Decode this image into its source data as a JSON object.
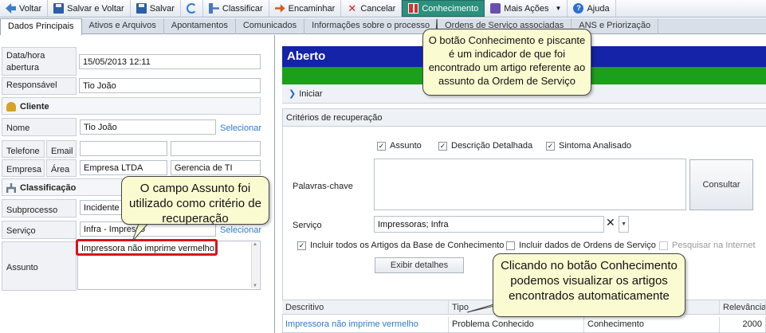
{
  "toolbar": {
    "back": "Voltar",
    "save_back": "Salvar e Voltar",
    "save": "Salvar",
    "classify": "Classificar",
    "forward": "Encaminhar",
    "cancel": "Cancelar",
    "knowledge": "Conhecimento",
    "more_actions": "Mais Ações",
    "help": "Ajuda"
  },
  "tabs": [
    "Dados Principais",
    "Ativos e Arquivos",
    "Apontamentos",
    "Comunicados",
    "Informações sobre o processo",
    "Ordens de Serviço associadas",
    "ANS e Priorização"
  ],
  "form": {
    "date_label": "Data/hora abertura",
    "date_value": "15/05/2013 12:11",
    "responsible_label": "Responsável",
    "responsible_value": "Tio João",
    "client_section": "Cliente",
    "name_label": "Nome",
    "name_value": "Tio João",
    "select_link": "Selecionar",
    "phone_label": "Telefone",
    "email_label": "Email",
    "company_label": "Empresa",
    "area_label": "Área",
    "company_value": "Empresa LTDA",
    "area_value": "Gerencia de TI",
    "classification_section": "Classificação",
    "subprocess_label": "Subprocesso",
    "subprocess_value": "Incidente -",
    "service_label": "Serviço",
    "service_value": "Infra - Impresso",
    "subject_label": "Assunto",
    "subject_value": "Impressora não imprime vermelho"
  },
  "right": {
    "status": "Aberto",
    "start": "Iniciar",
    "criteria_title": "Critérios de recuperação",
    "chk_subject": "Assunto",
    "chk_description": "Descrição Detalhada",
    "chk_symptom": "Sintoma Analisado",
    "keywords_label": "Palavras-chave",
    "consult_button": "Consultar",
    "service_label": "Serviço",
    "service_value": "Impressoras; Infra",
    "include_articles": "Incluir todos os Artigos da Base de Conhecimento",
    "include_orders": "Incluir dados de Ordens de Serviço",
    "search_internet": "Pesquisar na Internet",
    "details_button": "Exibir detalhes"
  },
  "grid": {
    "headers": [
      "Descritivo",
      "Tipo",
      "",
      "Relevância"
    ],
    "rows": [
      [
        "Impressora não imprime vermelho",
        "Problema Conhecido",
        "Conhecimento",
        "2000"
      ]
    ]
  },
  "callouts": {
    "knowledge_button": "O botão Conhecimento e piscante é um indicador de que foi encontrado um artigo referente ao assunto da Ordem de Serviço",
    "subject_field": "O campo Assunto foi utilizado como critério de recuperação",
    "view_articles": "Clicando no botão Conhecimento podemos visualizar os artigos encontrados automaticamente"
  },
  "colors": {
    "status_bar": "#1423a8",
    "green_bar": "#1aa01a",
    "knowledge_active": "#2d8f7d",
    "highlight": "#e0101a"
  }
}
